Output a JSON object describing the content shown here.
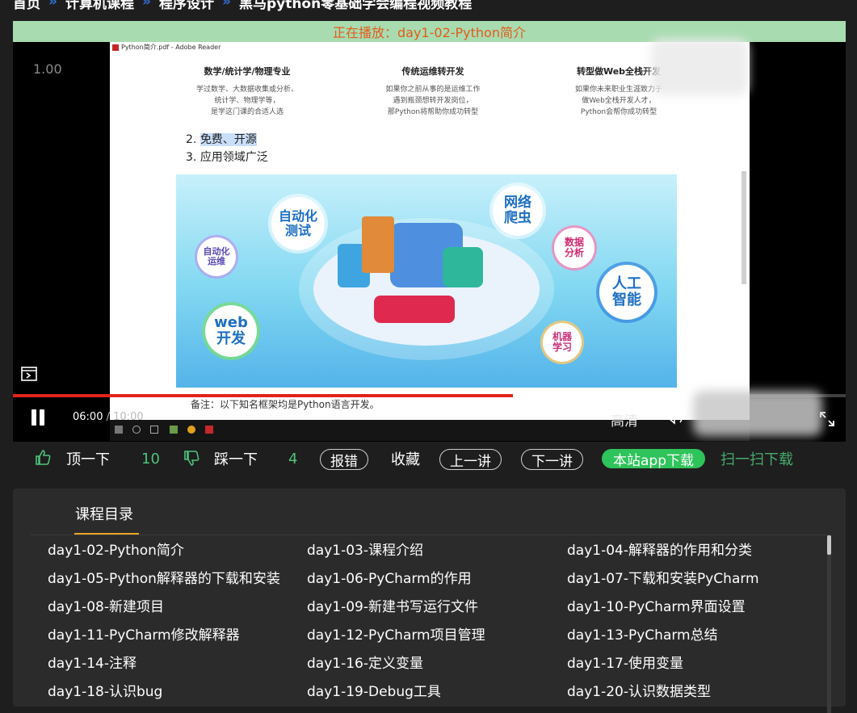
{
  "breadcrumb": [
    "首页",
    "计算机课程",
    "程序设计",
    "黑马python零基础学会编程视频教程"
  ],
  "breadcrumb_sep": "»",
  "player": {
    "now_playing": "正在播放：day1-02-Python简介",
    "speed": "1.00",
    "current_time": "06:00",
    "time_sep": "/",
    "duration": "10:00",
    "progress": 0.6,
    "quality": "高清",
    "video": {
      "window_title": "Python简介.pdf - Adobe Reader",
      "columns": [
        {
          "heading": "数学/统计学/物理专业",
          "desc": "学过数学、大数据收集或分析、\n统计学、物理学等，\n是学这门课的合适人选"
        },
        {
          "heading": "传统运维转开发",
          "desc": "如果你之前从事的是运维工作\n遇到瓶颈想转开发岗位，\n那Python将帮助你成功转型"
        },
        {
          "heading": "转型做Web全栈开发",
          "desc": "如果你未来职业生涯致力于\n做Web全栈开发人才，\nPython会帮你成功转型"
        }
      ],
      "points": [
        {
          "num": "2.",
          "text": "免费、开源",
          "highlight": true
        },
        {
          "num": "3.",
          "text": "应用领域广泛",
          "highlight": false
        }
      ],
      "bubbles": [
        "自动化\n测试",
        "自动化\n运维",
        "web\n开发",
        "网络\n爬虫",
        "数据\n分析",
        "人工\n智能",
        "机器\n学习"
      ],
      "note": "备注：以下知名框架均是Python语言开发。"
    }
  },
  "actions": {
    "like_label": "顶一下",
    "like_count": "10",
    "dislike_label": "踩一下",
    "dislike_count": "4",
    "report": "报错",
    "favorite": "收藏",
    "prev": "上一讲",
    "next": "下一讲",
    "app_download": "本站app下载",
    "scan_download": "扫一扫下载"
  },
  "catalog": {
    "title": "课程目录",
    "items": [
      "day1-02-Python简介",
      "day1-03-课程介绍",
      "day1-04-解释器的作用和分类",
      "day1-05-Python解释器的下载和安装",
      "day1-06-PyCharm的作用",
      "day1-07-下载和安装PyCharm",
      "day1-08-新建项目",
      "day1-09-新建书写运行文件",
      "day1-10-PyCharm界面设置",
      "day1-11-PyCharm修改解释器",
      "day1-12-PyCharm项目管理",
      "day1-13-PyCharm总结",
      "day1-14-注释",
      "day1-16-定义变量",
      "day1-17-使用变量",
      "day1-18-认识bug",
      "day1-19-Debug工具",
      "day1-20-认识数据类型"
    ]
  },
  "colors": {
    "accent_green": "#2fc35b",
    "progress_red": "#e2231a",
    "now_playing_bg": "#a8dcb0",
    "tab_underline": "#e8a628"
  }
}
